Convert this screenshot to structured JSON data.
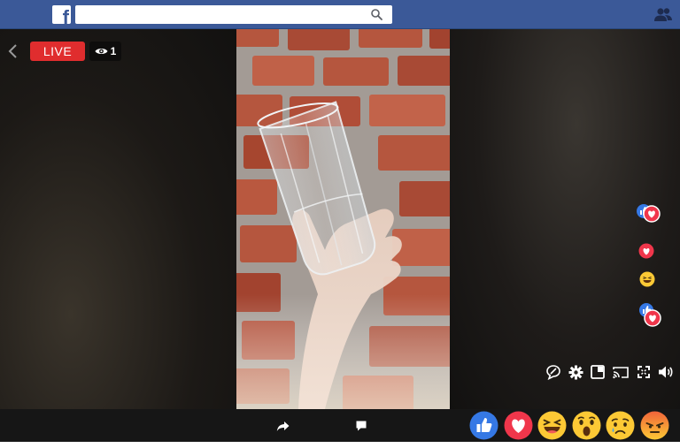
{
  "topbar": {
    "logo_letter": "f",
    "search": {
      "value": "",
      "placeholder": ""
    }
  },
  "video": {
    "live_label": "LIVE",
    "viewer_count": "1"
  },
  "floating_reactions": [
    "like",
    "love",
    "love",
    "haha",
    "like",
    "love"
  ],
  "player_controls": [
    "comment-toggle-icon",
    "settings-icon",
    "picture-in-picture-icon",
    "cast-icon",
    "fullscreen-icon",
    "volume-icon"
  ],
  "bottom_actions": [
    "share-icon",
    "comment-icon"
  ],
  "reactions": [
    "like",
    "love",
    "haha",
    "wow",
    "sad",
    "angry"
  ],
  "colors": {
    "brand": "#3b5998",
    "live": "#e02d2e",
    "like": "#3578e5",
    "love": "#f0364b",
    "emoji": "#fcc935",
    "angry": "#f0643a"
  }
}
